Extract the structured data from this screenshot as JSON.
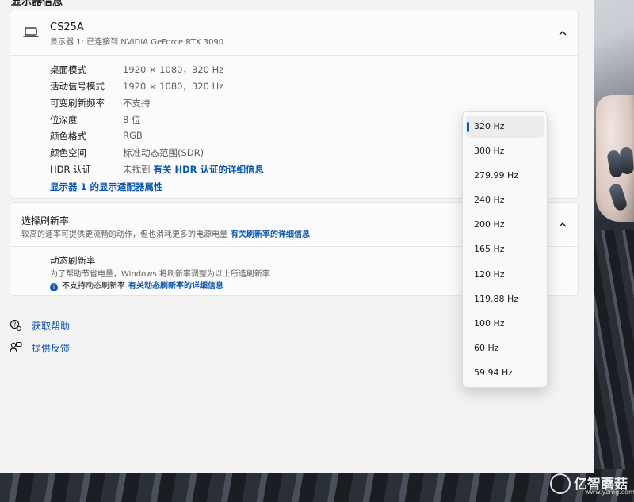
{
  "header": {
    "section_title": "显示器信息"
  },
  "display": {
    "name": "CS25A",
    "subtitle": "显示器 1: 已连接到 NVIDIA GeForce RTX 3090",
    "rows": [
      {
        "label": "桌面模式",
        "value": "1920 × 1080，320 Hz"
      },
      {
        "label": "活动信号模式",
        "value": "1920 × 1080，320 Hz"
      },
      {
        "label": "可变刷新频率",
        "value": "不支持"
      },
      {
        "label": "位深度",
        "value": "8 位"
      },
      {
        "label": "颜色格式",
        "value": "RGB"
      },
      {
        "label": "颜色空间",
        "value": "标准动态范围(SDR)"
      },
      {
        "label": "HDR 认证",
        "value": "未找到",
        "link": "有关 HDR 认证的详细信息"
      }
    ],
    "adapter_link": "显示器 1 的显示适配器属性"
  },
  "refresh": {
    "title": "选择刷新率",
    "description": "较高的速率可提供更流畅的动作，但也消耗更多的电源电量",
    "description_link": "有关刷新率的详细信息",
    "dynamic_title": "动态刷新率",
    "dynamic_description": "为了帮助节省电量，Windows 将刷新率调整为以上所选刷新率",
    "dynamic_note": "不支持动态刷新率",
    "dynamic_note_link": "有关动态刷新率的详细信息"
  },
  "help": {
    "get_help": "获取帮助",
    "feedback": "提供反馈"
  },
  "dropdown": {
    "selected": "320 Hz",
    "options": [
      "320 Hz",
      "300 Hz",
      "279.99 Hz",
      "240 Hz",
      "200 Hz",
      "165 Hz",
      "120 Hz",
      "119.88 Hz",
      "100 Hz",
      "60 Hz",
      "59.94 Hz"
    ]
  },
  "watermark": {
    "brand": "亿智蘑菇",
    "url": "www.yzmg.com"
  },
  "colors": {
    "accent": "#005fb8",
    "link": "#0b57b0",
    "card": "#fbfbfb",
    "window": "#f3f3f3"
  }
}
